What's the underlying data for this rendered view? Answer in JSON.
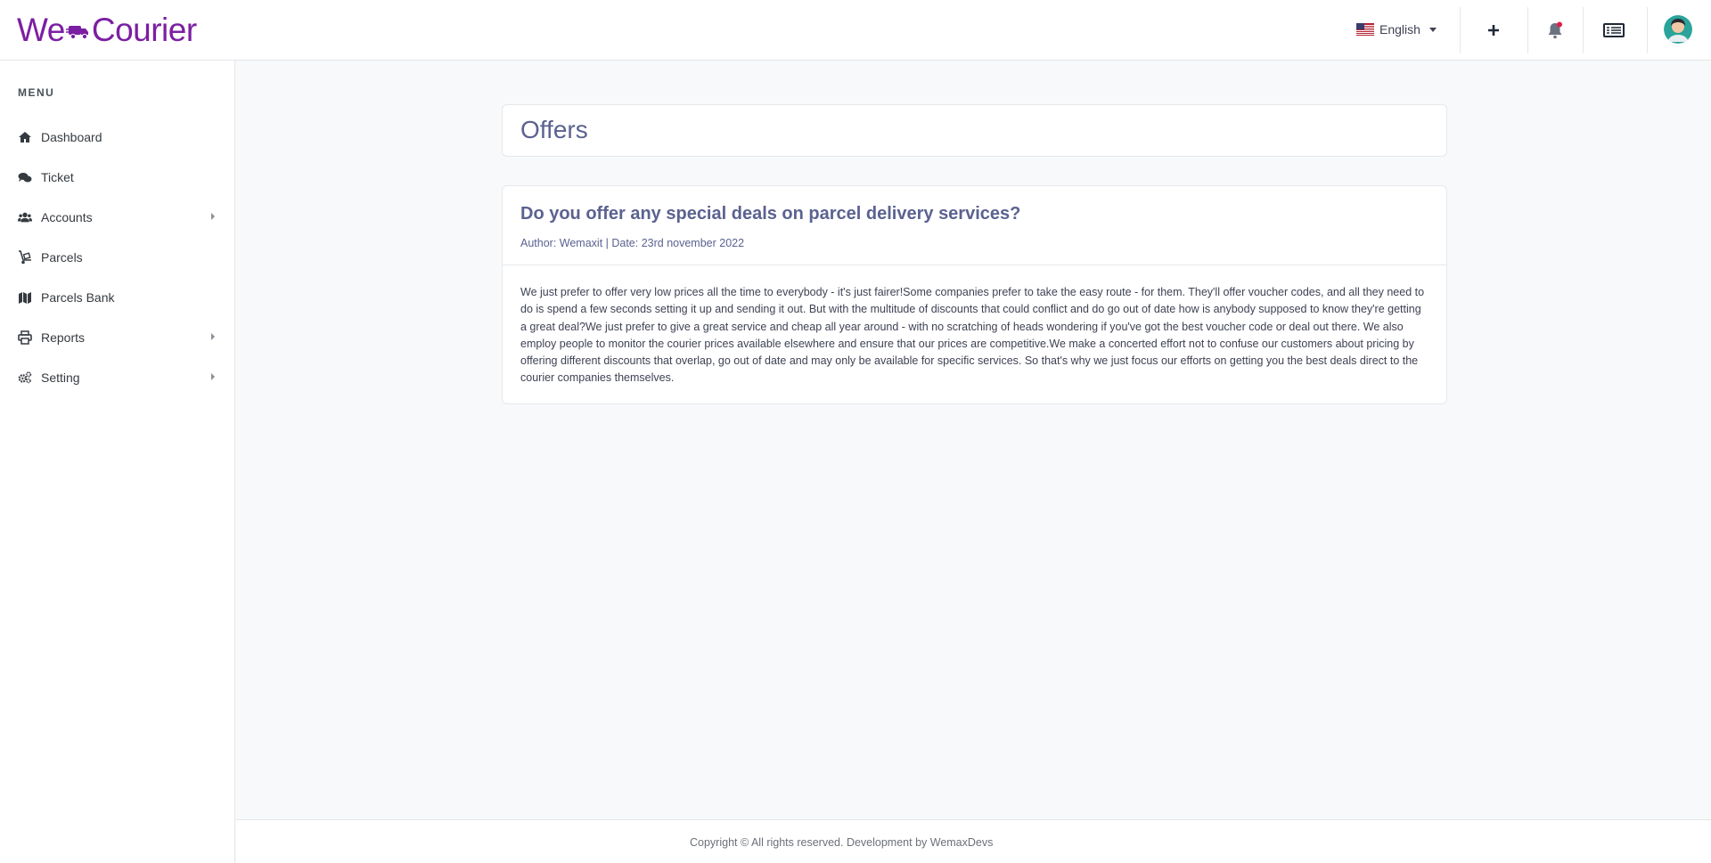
{
  "header": {
    "logo_text_left": "We",
    "logo_text_right": "Courier",
    "language": "English",
    "language_flag": "us-flag-icon",
    "add_icon": "plus-icon",
    "notification_icon": "bell-icon",
    "menu_icon": "list-icon",
    "brand_color": "#7b1fa2"
  },
  "sidebar": {
    "menu_title": "MENU",
    "items": [
      {
        "label": "Dashboard",
        "icon": "home-icon",
        "has_submenu": false
      },
      {
        "label": "Ticket",
        "icon": "comments-icon",
        "has_submenu": false
      },
      {
        "label": "Accounts",
        "icon": "users-icon",
        "has_submenu": true
      },
      {
        "label": "Parcels",
        "icon": "dolly-icon",
        "has_submenu": false
      },
      {
        "label": "Parcels Bank",
        "icon": "map-icon",
        "has_submenu": false
      },
      {
        "label": "Reports",
        "icon": "print-icon",
        "has_submenu": true
      },
      {
        "label": "Setting",
        "icon": "gears-icon",
        "has_submenu": true
      }
    ]
  },
  "main": {
    "page_title": "Offers",
    "offer": {
      "question": "Do you offer any special deals on parcel delivery services?",
      "meta": "Author: Wemaxit | Date: 23rd november 2022",
      "body": "We just prefer to offer very low prices all the time to everybody - it's just fairer!Some companies prefer to take the easy route - for them. They'll offer voucher codes, and all they need to do is spend a few seconds setting it up and sending it out. But with the multitude of discounts that could conflict and do go out of date how is anybody supposed to know they're getting a great deal?We just prefer to give a great service and cheap all year around - with no scratching of heads wondering if you've got the best voucher code or deal out there. We also employ people to monitor the courier prices available elsewhere and ensure that our prices are competitive.We make a concerted effort not to confuse our customers about pricing by offering different discounts that overlap, go out of date and may only be available for specific services. So that's why we just focus our efforts on getting you the best deals direct to the courier companies themselves."
    }
  },
  "footer": {
    "text": "Copyright © All rights reserved. Development by WemaxDevs"
  }
}
